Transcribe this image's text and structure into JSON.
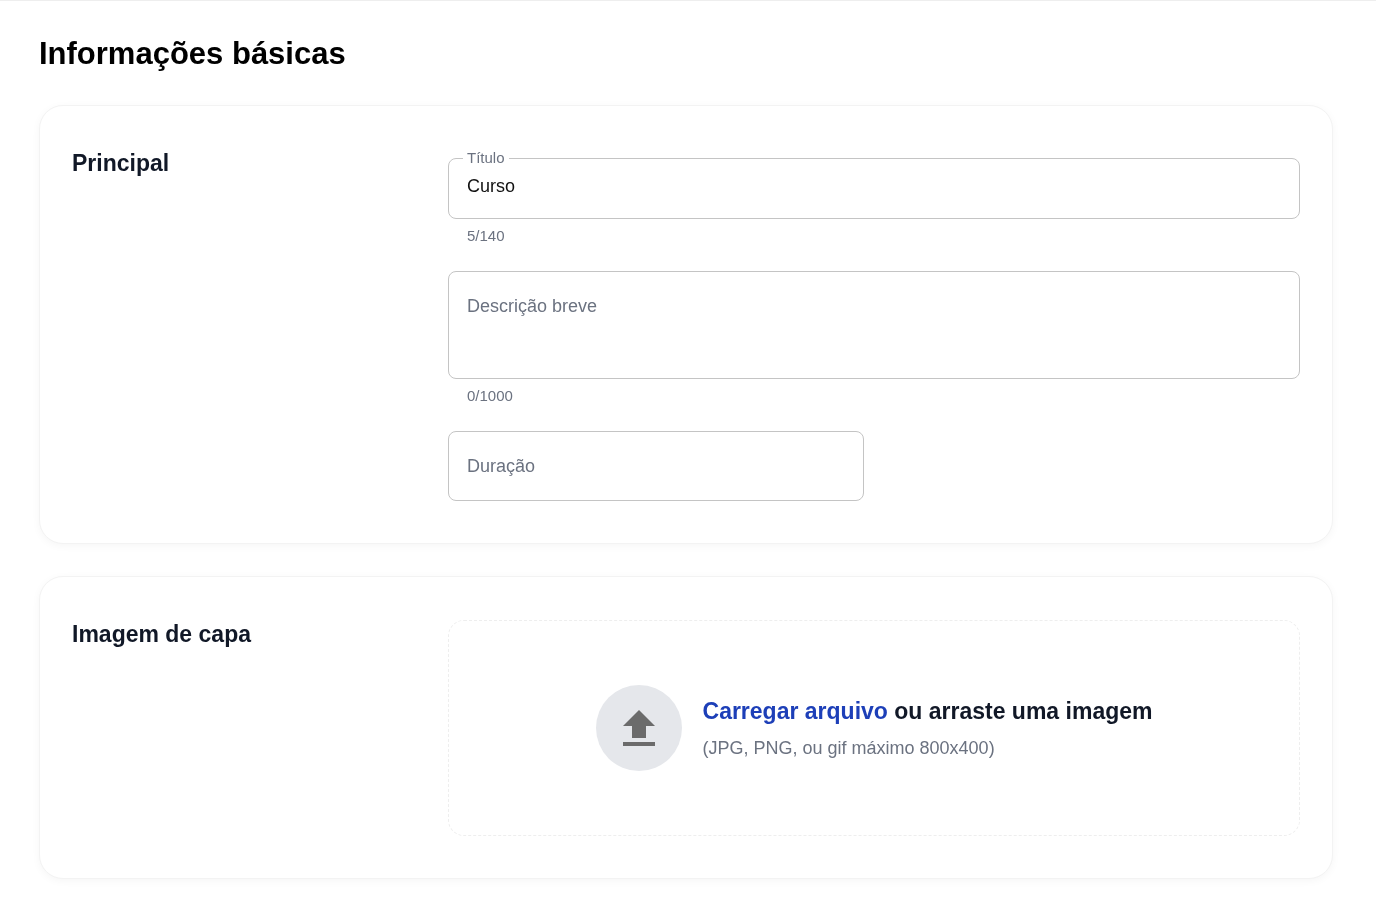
{
  "page_title": "Informações básicas",
  "sections": [
    {
      "title": "Principal",
      "kind": "fields",
      "fields": [
        {
          "label": "Título",
          "value": "Curso",
          "counter": "5/140",
          "kind": "line"
        },
        {
          "placeholder": "Descrição breve",
          "counter": "0/1000",
          "kind": "area"
        },
        {
          "placeholder": "Duração",
          "kind": "short"
        }
      ]
    },
    {
      "title": "Imagem de capa",
      "kind": "upload",
      "upload": {
        "link": "Carregar arquivo",
        "text": "ou arraste uma imagem",
        "hint": "(JPG, PNG, ou gif máximo 800x400)"
      }
    }
  ]
}
